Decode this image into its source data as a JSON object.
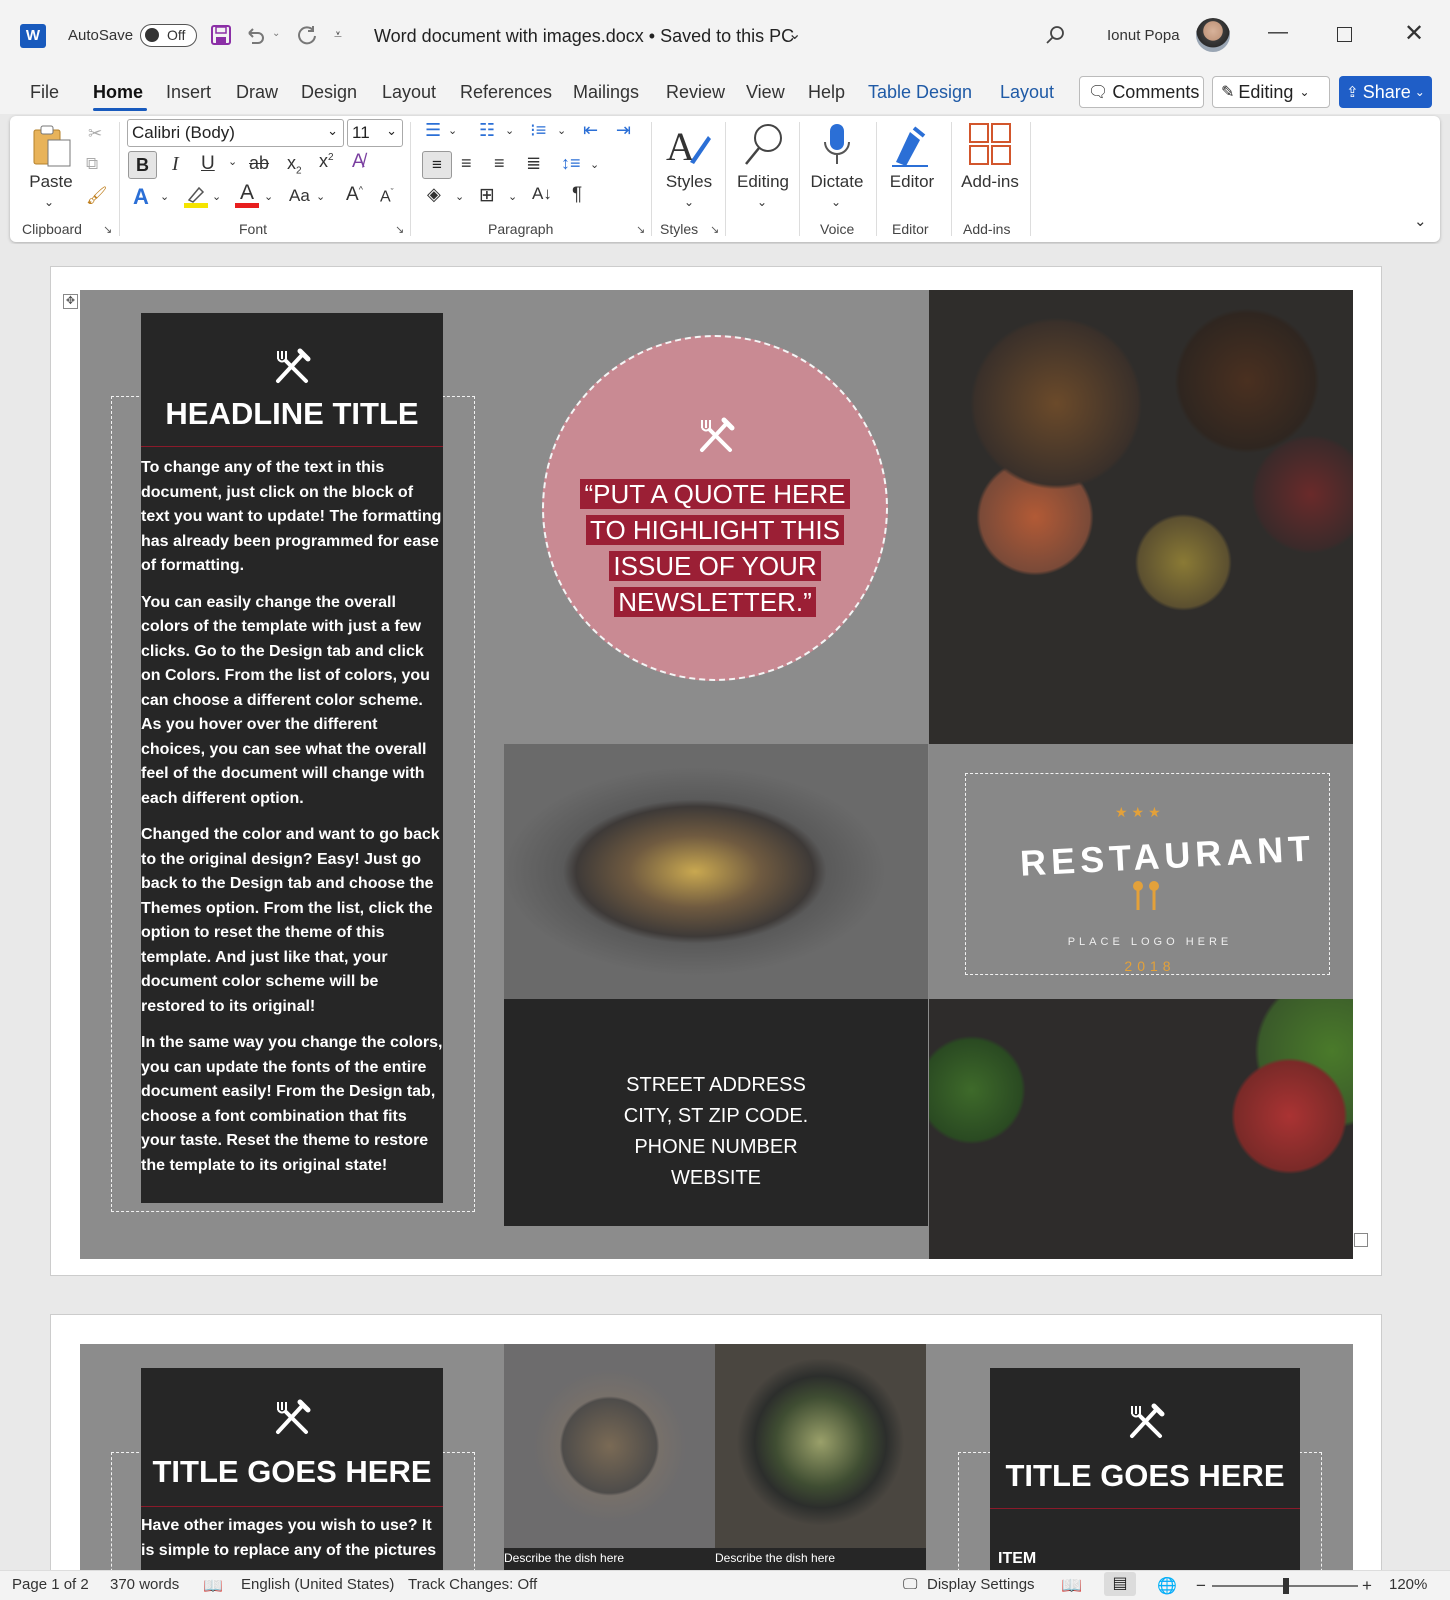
{
  "titlebar": {
    "autosave_label": "AutoSave",
    "autosave_state": "Off",
    "doc_title": "Word document with images.docx • Saved to this PC",
    "user_name": "Ionut Popa"
  },
  "menu": {
    "items": [
      "File",
      "Home",
      "Insert",
      "Draw",
      "Design",
      "Layout",
      "References",
      "Mailings",
      "Review",
      "View",
      "Help",
      "Table Design",
      "Layout"
    ],
    "active": "Home",
    "comments": "Comments",
    "editing": "Editing",
    "share": "Share"
  },
  "ribbon": {
    "paste": "Paste",
    "font_name": "Calibri (Body)",
    "font_size": "11",
    "styles": "Styles",
    "editing": "Editing",
    "dictate": "Dictate",
    "editor": "Editor",
    "addins": "Add-ins",
    "groups": {
      "clipboard": "Clipboard",
      "font": "Font",
      "paragraph": "Paragraph",
      "styles": "Styles",
      "voice": "Voice",
      "editor": "Editor",
      "addins": "Add-ins"
    }
  },
  "document": {
    "page1": {
      "headline": "HEADLINE TITLE",
      "paragraphs": [
        "To change any of the text in this document, just click on the block of text you want to update!  The formatting has already been programmed for ease of formatting.",
        "You can easily change the overall colors of the template with just a few clicks.  Go to the Design tab and click on Colors.  From the list of colors, you can choose a different color scheme.  As you hover over the different choices, you can see what the overall feel of the document will change with each different option.",
        "Changed the color and want to go back to the original design?  Easy!  Just go back to the Design tab and choose the Themes option.  From the list, click the option to reset the theme of this template.  And just like that, your document color scheme will be restored to its original!",
        "In the same way you change the colors, you can update the fonts of the entire document easily!  From the Design tab, choose a font combination that fits your taste.  Reset the theme to restore the template to its original state!"
      ],
      "quote_lines": [
        "“PUT A QUOTE HERE",
        "TO HIGHLIGHT THIS",
        "ISSUE OF YOUR",
        "NEWSLETTER.”"
      ],
      "logo_word": "RESTAURANT",
      "logo_sub": "PLACE LOGO HERE",
      "logo_year": "2018",
      "address_lines": [
        "STREET ADDRESS",
        "CITY, ST ZIP CODE.",
        "PHONE NUMBER",
        "WEBSITE"
      ]
    },
    "page2": {
      "left_title": "TITLE GOES HERE",
      "left_text": "Have other images you wish to use?  It is simple to replace any of the pictures",
      "caption1": "Describe the dish here",
      "caption2": "Describe the dish here",
      "right_title": "TITLE GOES HERE",
      "item_label": "ITEM"
    },
    "colors": {
      "quote_circle": "#c98a93",
      "quote_highlight": "#9b1f35",
      "panel_dark": "#262626",
      "panel_gray": "#8c8c8c",
      "accent_red": "#8b1a2a"
    }
  },
  "statusbar": {
    "page": "Page 1 of 2",
    "words": "370 words",
    "language": "English (United States)",
    "track_changes": "Track Changes: Off",
    "display_settings": "Display Settings",
    "zoom": "120%"
  }
}
